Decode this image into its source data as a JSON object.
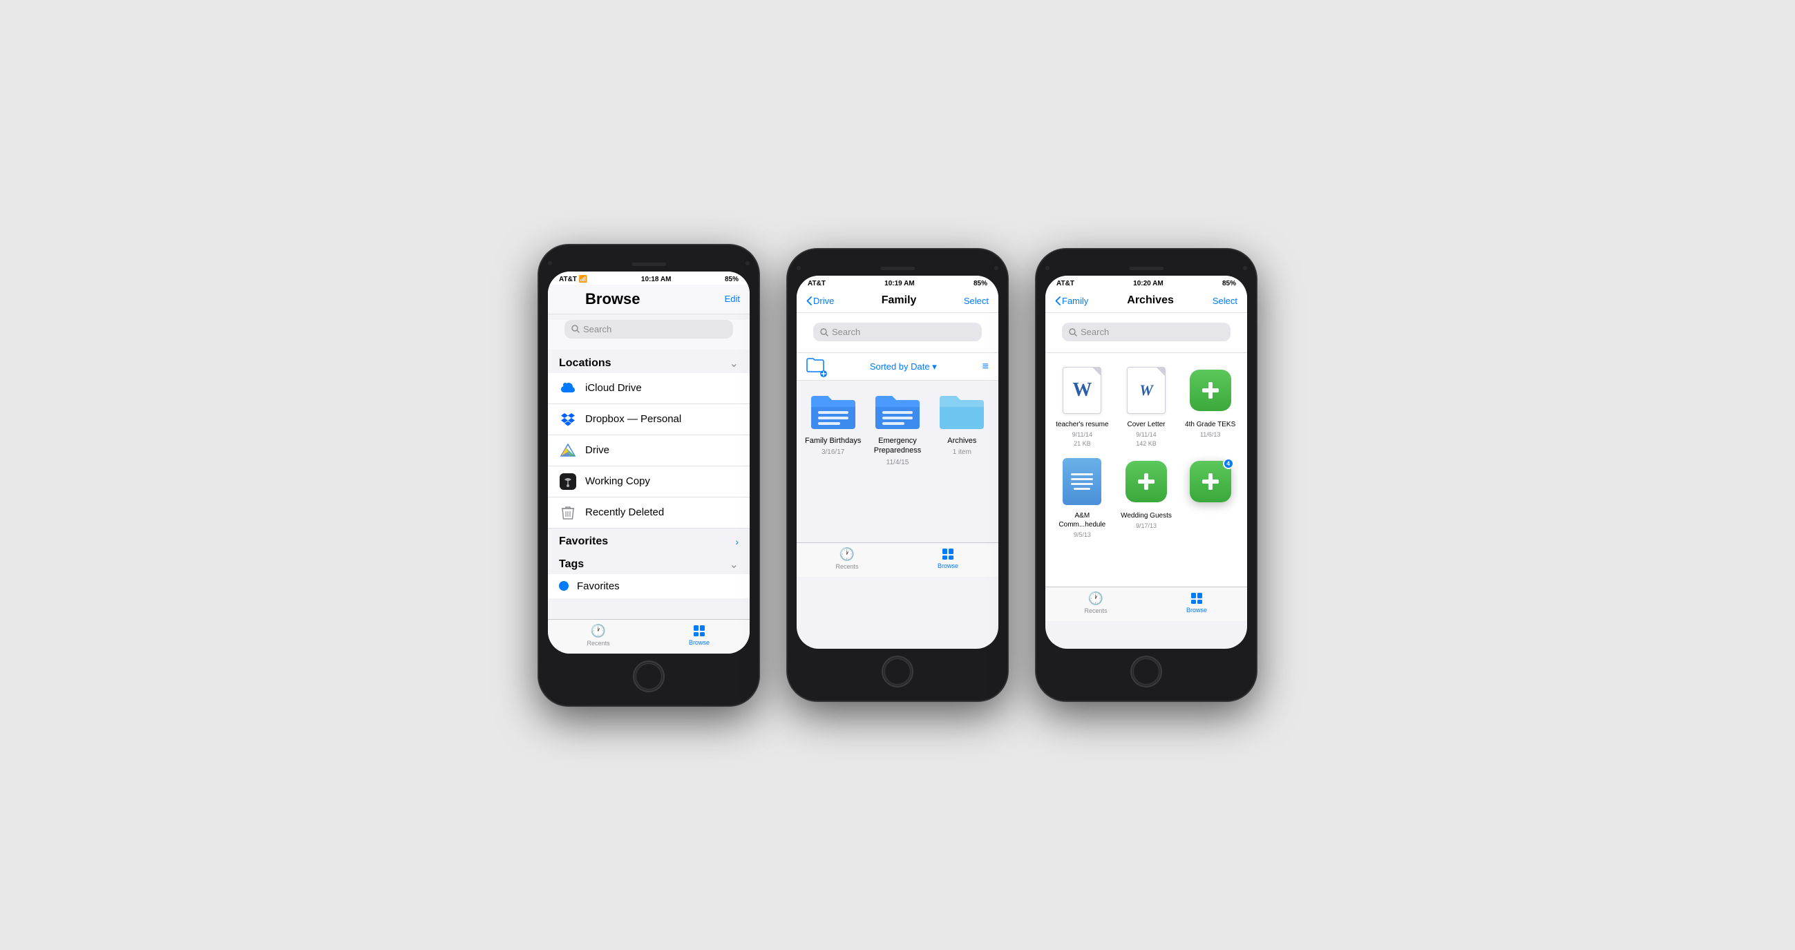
{
  "phone1": {
    "status": {
      "carrier": "AT&T",
      "time": "10:18 AM",
      "battery": "85%"
    },
    "nav": {
      "title": "Browse",
      "edit": "Edit"
    },
    "search": {
      "placeholder": "Search"
    },
    "locations": {
      "header": "Locations",
      "items": [
        {
          "name": "iCloud Drive",
          "icon": "icloud"
        },
        {
          "name": "Dropbox — Personal",
          "icon": "dropbox"
        },
        {
          "name": "Drive",
          "icon": "drive"
        },
        {
          "name": "Working Copy",
          "icon": "working-copy"
        },
        {
          "name": "Recently Deleted",
          "icon": "trash"
        }
      ]
    },
    "favorites": {
      "header": "Favorites"
    },
    "tags": {
      "header": "Tags",
      "items": [
        {
          "name": "Favorites",
          "color": "#007aff"
        }
      ]
    },
    "tabs": [
      {
        "label": "Recents",
        "icon": "🕐",
        "active": false
      },
      {
        "label": "Browse",
        "icon": "📁",
        "active": true
      }
    ]
  },
  "phone2": {
    "status": {
      "carrier": "AT&T",
      "time": "10:19 AM",
      "battery": "85%"
    },
    "nav": {
      "back": "Drive",
      "title": "Family",
      "action": "Select"
    },
    "search": {
      "placeholder": "Search"
    },
    "toolbar": {
      "sort_label": "Sorted by Date ▾"
    },
    "folders": [
      {
        "name": "Family Birthdays",
        "date": "3/16/17",
        "type": "doc"
      },
      {
        "name": "Emergency Preparedness",
        "date": "11/4/15",
        "type": "doc"
      },
      {
        "name": "Archives",
        "date": "1 item",
        "type": "folder"
      }
    ],
    "tabs": [
      {
        "label": "Recents",
        "icon": "🕐",
        "active": false
      },
      {
        "label": "Browse",
        "icon": "📁",
        "active": true
      }
    ]
  },
  "phone3": {
    "status": {
      "carrier": "AT&T",
      "time": "10:20 AM",
      "battery": "85%"
    },
    "nav": {
      "back": "Family",
      "title": "Archives",
      "action": "Select"
    },
    "search": {
      "placeholder": "Search"
    },
    "files": [
      {
        "name": "teacher's resume",
        "date": "9/11/14",
        "size": "21 KB",
        "type": "word"
      },
      {
        "name": "Cover Letter",
        "date": "9/11/14",
        "size": "142 KB",
        "type": "word"
      },
      {
        "name": "4th Grade TEKS",
        "date": "11/6/13",
        "size": "",
        "type": "cross-green"
      },
      {
        "name": "A&M Comm...hedule",
        "date": "9/5/13",
        "size": "",
        "type": "blue-doc"
      },
      {
        "name": "Wedding Guests",
        "date": "9/17/13",
        "size": "",
        "type": "cross-green"
      }
    ],
    "floating_app": {
      "badge": "4",
      "type": "cross-green"
    },
    "tabs": [
      {
        "label": "Recents",
        "icon": "🕐",
        "active": false
      },
      {
        "label": "Browse",
        "icon": "📁",
        "active": true
      }
    ]
  }
}
